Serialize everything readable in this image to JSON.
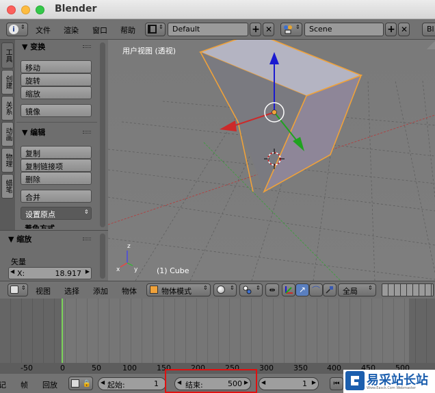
{
  "window": {
    "title": "Blender"
  },
  "info_header": {
    "menus": [
      "文件",
      "渲染",
      "窗口",
      "帮助"
    ],
    "layout": "Default",
    "scene": "Scene",
    "engine_partial": "Bl"
  },
  "tool_tabs": [
    "工具",
    "创建",
    "关系",
    "动画",
    "物理",
    "蜡笔"
  ],
  "tool_shelf": {
    "transform_header": "▼ 变换",
    "transform_buttons": [
      "移动",
      "旋转",
      "缩放"
    ],
    "mirror_button": "镜像",
    "edit_header": "▼ 编辑",
    "edit_buttons": [
      "复制",
      "复制链接项",
      "删除"
    ],
    "join_button": "合并",
    "set_origin": "设置原点",
    "cut_text": "着色方式"
  },
  "operator_panel": {
    "header": "▼ 缩放",
    "vector_label": "矢量",
    "x_label": "X:",
    "x_value": "18.917"
  },
  "viewport": {
    "view_label": "用户视图 (透视)",
    "object_label": "(1) Cube",
    "axis_z": "z",
    "axis_x": "x",
    "axis_y": "y"
  },
  "view_header": {
    "menus": [
      "视图",
      "选择",
      "添加",
      "物体"
    ],
    "mode": "物体模式",
    "pivot": "全局"
  },
  "ruler": {
    "labels": [
      "-50",
      "0",
      "50",
      "100",
      "150",
      "200",
      "250",
      "300",
      "350",
      "400",
      "450",
      "500"
    ]
  },
  "timeline_header": {
    "partial_left": "记",
    "frame_label": "帧",
    "playback_label": "回放",
    "start_label": "起始:",
    "start_value": "1",
    "end_label": "结束:",
    "end_value": "500",
    "current_frame": "1"
  },
  "watermark": {
    "brand": "易采站长站",
    "url": "Www.Easck.Com Webmaster"
  },
  "colors": {
    "selection_orange": "#f0a23a",
    "axis_red": "#cc2a2a",
    "axis_green": "#1fa31f",
    "axis_blue": "#1a1ad0",
    "playhead_green": "#7bd35a",
    "highlight_red": "#e01010"
  }
}
